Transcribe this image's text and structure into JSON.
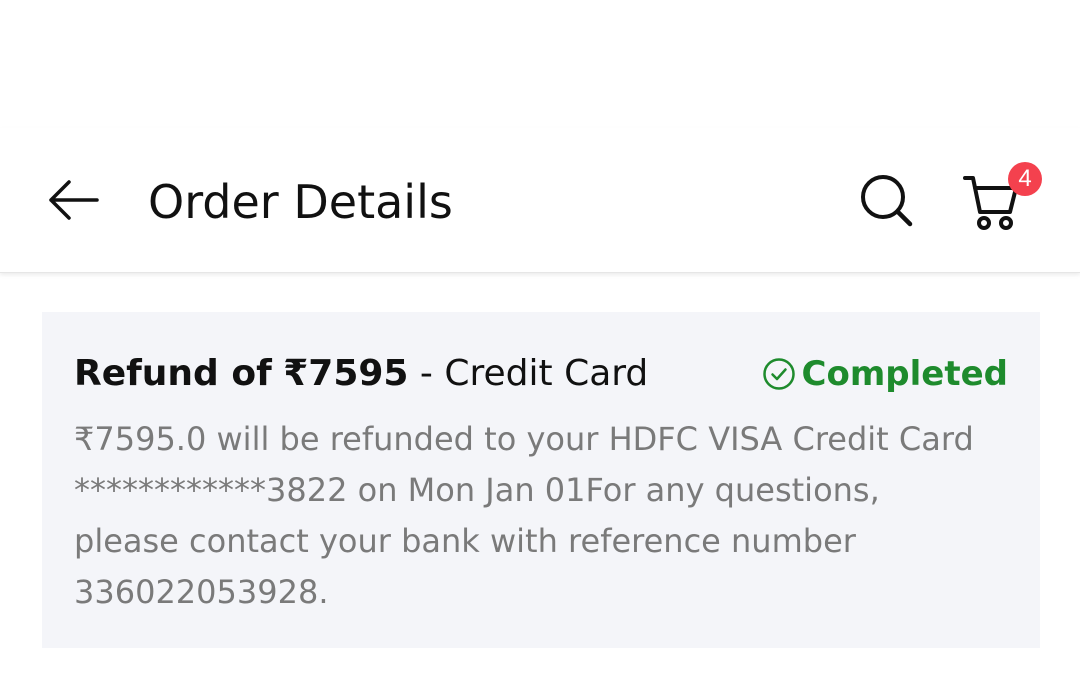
{
  "app_bar": {
    "title": "Order Details",
    "back_icon": "arrow-left-icon",
    "search_icon": "search-icon",
    "cart_icon": "cart-icon",
    "cart_count": "4"
  },
  "refund": {
    "prefix": "Refund of",
    "amount": "₹7595",
    "separator": " - ",
    "method": "Credit Card",
    "status": "Completed",
    "status_icon": "check-circle-icon",
    "message": "₹7595.0 will be refunded to your HDFC VISA Credit Card ************3822 on Mon Jan 01For any questions, please contact your bank with reference number 336022053928."
  },
  "colors": {
    "status_green": "#1e8b2d",
    "badge_red": "#f4414e",
    "card_background": "#f4f5f9",
    "message_gray": "#7a7a7a"
  }
}
